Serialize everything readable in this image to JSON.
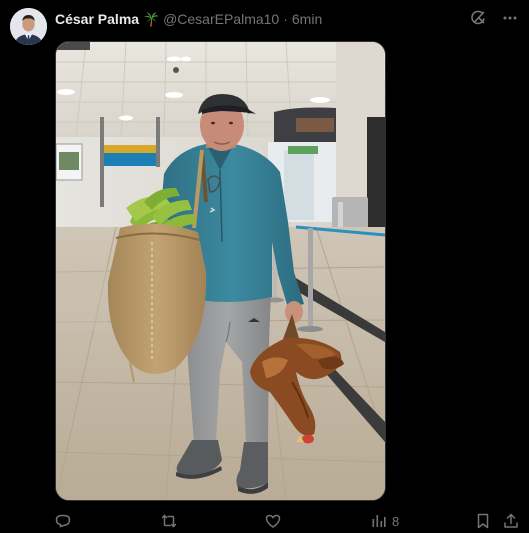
{
  "tweet": {
    "author_name": "César Palma",
    "handle": "@CesarEPalma10",
    "separator": "·",
    "time": "6min",
    "views_count": "8"
  },
  "icons": {
    "palm": "palm-tree-icon",
    "grok": "grok-icon",
    "more": "more-icon",
    "reply": "reply-icon",
    "retweet": "retweet-icon",
    "like": "like-icon",
    "views": "views-icon",
    "bookmark": "bookmark-icon",
    "share": "share-icon"
  },
  "colors": {
    "background": "#000000",
    "text": "#e7e9ea",
    "muted": "#71767b"
  }
}
